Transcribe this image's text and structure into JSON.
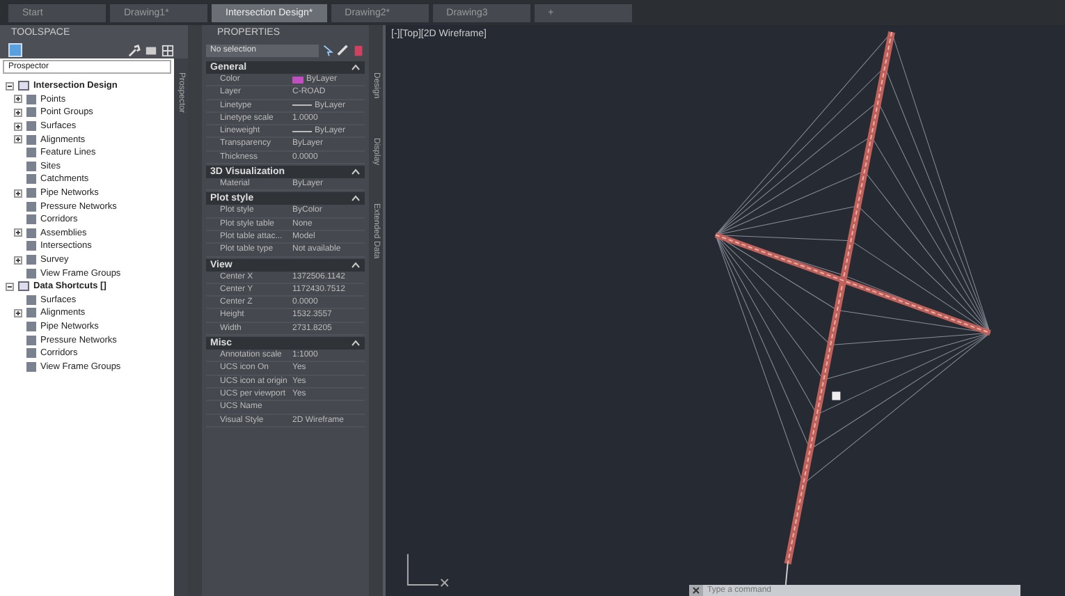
{
  "tabs": [
    {
      "label": "Start",
      "selected": false
    },
    {
      "label": "Drawing1*",
      "selected": false
    },
    {
      "label": "Intersection Design*",
      "selected": true
    },
    {
      "label": "Drawing2*",
      "selected": false
    },
    {
      "label": "Drawing3",
      "selected": false
    },
    {
      "label": "+",
      "selected": false
    }
  ],
  "toolspace": {
    "title": "TOOLSPACE",
    "view": "Prospector",
    "side_tab": "Prospector",
    "tree": [
      {
        "label": "Intersection Design",
        "expanded": true,
        "children": [
          {
            "label": "Points",
            "expanded": false
          },
          {
            "label": "Point Groups",
            "expanded": false
          },
          {
            "label": "Surfaces",
            "expanded": false
          },
          {
            "label": "Alignments",
            "expanded": false
          },
          {
            "label": "Feature Lines"
          },
          {
            "label": "Sites"
          },
          {
            "label": "Catchments"
          },
          {
            "label": "Pipe Networks",
            "expanded": false
          },
          {
            "label": "Pressure Networks"
          },
          {
            "label": "Corridors"
          },
          {
            "label": "Assemblies",
            "expanded": false
          },
          {
            "label": "Intersections"
          },
          {
            "label": "Survey",
            "expanded": false
          },
          {
            "label": "View Frame Groups"
          }
        ]
      },
      {
        "label": "Data Shortcuts []",
        "expanded": true,
        "children": [
          {
            "label": "Surfaces"
          },
          {
            "label": "Alignments",
            "expanded": false
          },
          {
            "label": "Pipe Networks"
          },
          {
            "label": "Pressure Networks"
          },
          {
            "label": "Corridors"
          },
          {
            "label": "View Frame Groups"
          }
        ]
      }
    ]
  },
  "properties": {
    "title": "PROPERTIES",
    "selection": "No selection",
    "side_tabs": [
      "Design",
      "Display",
      "Extended Data"
    ],
    "sections": [
      {
        "title": "General",
        "expanded": true,
        "rows": [
          {
            "label": "Color",
            "value": "ByLayer",
            "kind": "color"
          },
          {
            "label": "Layer",
            "value": "C-ROAD"
          },
          {
            "label": "Linetype",
            "value": "ByLayer",
            "kind": "linetype"
          },
          {
            "label": "Linetype scale",
            "value": "1.0000"
          },
          {
            "label": "Lineweight",
            "value": "ByLayer",
            "kind": "linetype"
          },
          {
            "label": "Transparency",
            "value": "ByLayer"
          },
          {
            "label": "Thickness",
            "value": "0.0000"
          }
        ]
      },
      {
        "title": "3D Visualization",
        "expanded": true,
        "rows": [
          {
            "label": "Material",
            "value": "ByLayer"
          }
        ]
      },
      {
        "title": "Plot style",
        "expanded": true,
        "rows": [
          {
            "label": "Plot style",
            "value": "ByColor"
          },
          {
            "label": "Plot style table",
            "value": "None"
          },
          {
            "label": "Plot table attac...",
            "value": "Model"
          },
          {
            "label": "Plot table type",
            "value": "Not available"
          }
        ]
      },
      {
        "title": "View",
        "expanded": true,
        "rows": [
          {
            "label": "Center X",
            "value": "1372506.1142"
          },
          {
            "label": "Center Y",
            "value": "1172430.7512"
          },
          {
            "label": "Center Z",
            "value": "0.0000"
          },
          {
            "label": "Height",
            "value": "1532.3557"
          },
          {
            "label": "Width",
            "value": "2731.8205"
          }
        ]
      },
      {
        "title": "Misc",
        "expanded": true,
        "rows": [
          {
            "label": "Annotation scale",
            "value": "1:1000"
          },
          {
            "label": "UCS icon On",
            "value": "Yes"
          },
          {
            "label": "UCS icon at origin",
            "value": "Yes"
          },
          {
            "label": "UCS per viewport",
            "value": "Yes"
          },
          {
            "label": "UCS Name",
            "value": ""
          },
          {
            "label": "Visual Style",
            "value": "2D Wireframe"
          }
        ]
      }
    ]
  },
  "viewport": {
    "label": "[-][Top][2D Wireframe]",
    "command_placeholder": "Type a command"
  }
}
